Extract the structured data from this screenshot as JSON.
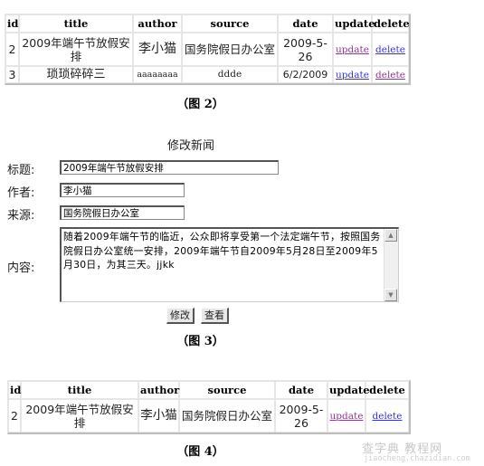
{
  "table_headers": [
    "id",
    "title",
    "author",
    "source",
    "date",
    "update",
    "delete"
  ],
  "figure2": {
    "rows": [
      {
        "id": "2",
        "title": "2009年端午节放假安排",
        "author": "李小猫",
        "source": "国务院假日办公室",
        "date": "2009-5-26",
        "update": "update",
        "delete": "delete"
      },
      {
        "id": "3",
        "title": "琐琐碎碎三",
        "author": "aaaaaaaa",
        "source": "ddde",
        "date": "6/2/2009",
        "update": "update",
        "delete": "delete"
      }
    ],
    "caption": "（图 2）"
  },
  "figure3": {
    "form_title": "修改新闻",
    "labels": {
      "title": "标题:",
      "author": "作者:",
      "source": "来源:",
      "content": "内容:"
    },
    "values": {
      "title": "2009年端午节放假安排",
      "author": "李小猫",
      "source": "国务院假日办公室",
      "content": "随着2009年端午节的临近，公众即将享受第一个法定端午节，按照国务院假日办公室统一安排，2009年端午节自2009年5月28日至2009年5月30日，为其三天。jjkk"
    },
    "buttons": {
      "modify": "修改",
      "view": "查看"
    },
    "caption": "（图 3）"
  },
  "figure4": {
    "rows": [
      {
        "id": "2",
        "title": "2009年端午节放假安排",
        "author": "李小猫",
        "source": "国务院假日办公室",
        "date": "2009-5-26",
        "update": "update",
        "delete": "delete"
      }
    ],
    "caption": "（图 4）"
  },
  "watermark": {
    "line1": "查字典 教程网",
    "line2": "jiaocheng.chazidian.com"
  }
}
